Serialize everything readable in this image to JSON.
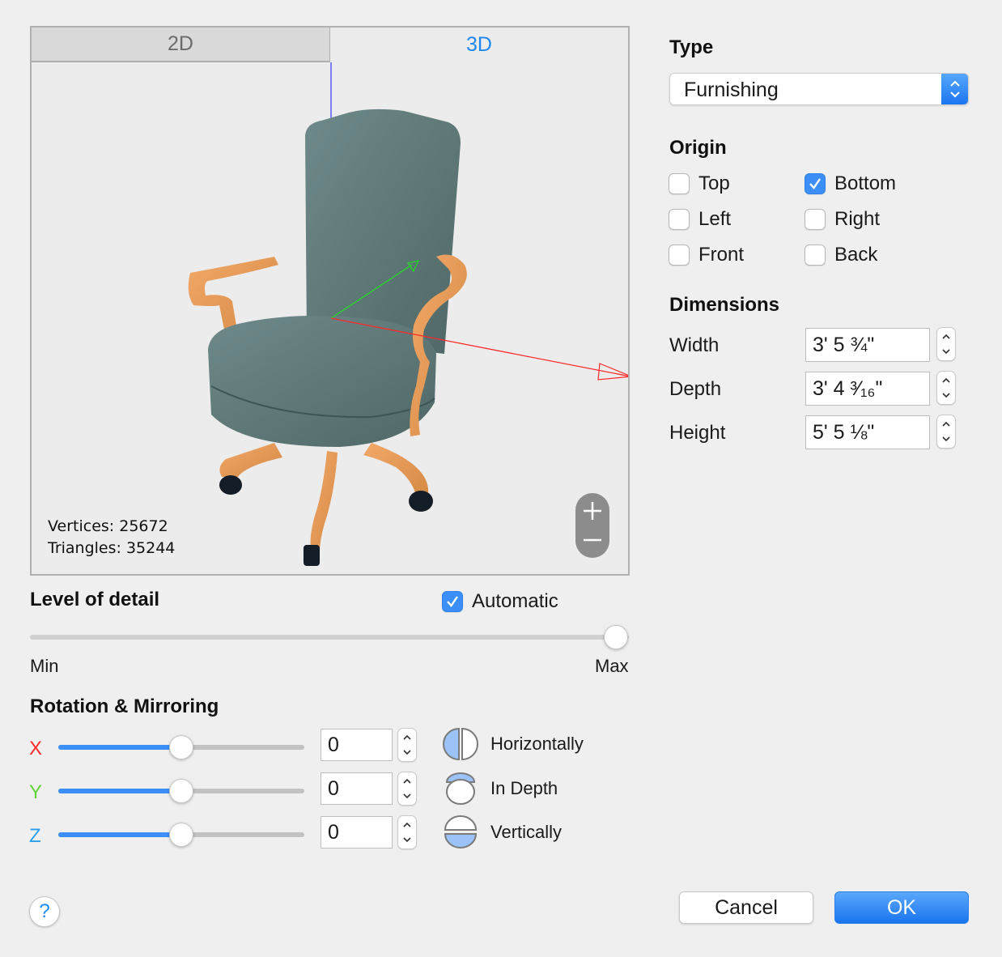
{
  "tabs": [
    {
      "label": "2D",
      "active": false
    },
    {
      "label": "3D",
      "active": true
    }
  ],
  "viewport": {
    "model": "office armchair",
    "vertices_label": "Vertices: 25672",
    "triangles_label": "Triangles: 35244",
    "zoom_in_icon": "plus-icon",
    "zoom_out_icon": "minus-icon",
    "axis_colors": {
      "x": "#ff2a2a",
      "y": "#22dd22",
      "z": "#5a5aff"
    }
  },
  "type": {
    "title": "Type",
    "selected": "Furnishing"
  },
  "origin": {
    "title": "Origin",
    "options": [
      {
        "label": "Top",
        "checked": false
      },
      {
        "label": "Bottom",
        "checked": true
      },
      {
        "label": "Left",
        "checked": false
      },
      {
        "label": "Right",
        "checked": false
      },
      {
        "label": "Front",
        "checked": false
      },
      {
        "label": "Back",
        "checked": false
      }
    ]
  },
  "dimensions": {
    "title": "Dimensions",
    "rows": [
      {
        "label": "Width",
        "value": "3' 5 ¾\""
      },
      {
        "label": "Depth",
        "value": "3' 4 ³⁄₁₆\""
      },
      {
        "label": "Height",
        "value": "5' 5 ⅛\""
      }
    ]
  },
  "level_of_detail": {
    "title": "Level of detail",
    "automatic_label": "Automatic",
    "automatic_checked": true,
    "min_label": "Min",
    "max_label": "Max",
    "value_fraction": 1.0
  },
  "rotation": {
    "title": "Rotation & Mirroring",
    "axes": [
      {
        "label": "X",
        "color": "#ff2a2a",
        "value": "0",
        "slider_fraction": 0.5
      },
      {
        "label": "Y",
        "color": "#5ed43a",
        "value": "0",
        "slider_fraction": 0.5
      },
      {
        "label": "Z",
        "color": "#2c9ef0",
        "value": "0",
        "slider_fraction": 0.5
      }
    ],
    "mirror": [
      {
        "label": "Horizontally",
        "icon": "mirror-horizontal-icon"
      },
      {
        "label": "In Depth",
        "icon": "mirror-depth-icon"
      },
      {
        "label": "Vertically",
        "icon": "mirror-vertical-icon"
      }
    ]
  },
  "footer": {
    "help_label": "?",
    "cancel_label": "Cancel",
    "ok_label": "OK"
  },
  "colors": {
    "accent": "#3b8ff6",
    "tab_active_text": "#1e88f0"
  }
}
